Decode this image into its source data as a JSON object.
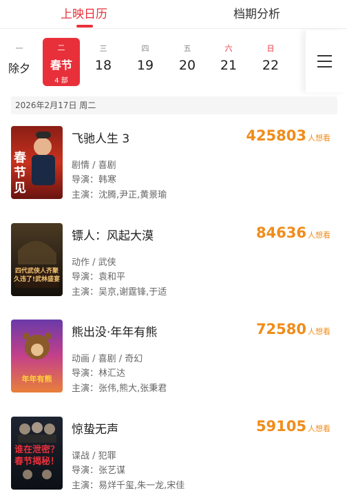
{
  "tabs": {
    "active": "上映日历",
    "inactive": "档期分析"
  },
  "dates": [
    {
      "weekday": "一",
      "day": "除夕",
      "sub": ""
    },
    {
      "weekday": "二",
      "day": "春节",
      "sub": "4 部"
    },
    {
      "weekday": "三",
      "day": "18",
      "sub": ""
    },
    {
      "weekday": "四",
      "day": "19",
      "sub": ""
    },
    {
      "weekday": "五",
      "day": "20",
      "sub": ""
    },
    {
      "weekday": "六",
      "day": "21",
      "sub": ""
    },
    {
      "weekday": "日",
      "day": "22",
      "sub": ""
    }
  ],
  "selected_date_index": 1,
  "menu_icon": "hamburger-menu-icon",
  "date_header": "2026年2月17日  周二",
  "want_unit": "人想看",
  "accent_color": "#e8303a",
  "want_color": "#f08c1a",
  "movies": [
    {
      "title": "飞驰人生 3",
      "want_count": "425803",
      "genre": "剧情 / 喜剧",
      "director": "导演：韩寒",
      "cast": "主演：沈腾,尹正,黄景瑜",
      "poster_text": "春节见"
    },
    {
      "title": "镖人：风起大漠",
      "want_count": "84636",
      "genre": "动作 / 武侠",
      "director": "导演：袁和平",
      "cast": "主演：吴京,谢霆锋,于适",
      "poster_text": "四代武侠人齐聚 久违了!武林盛宴"
    },
    {
      "title": "熊出没·年年有熊",
      "want_count": "72580",
      "genre": "动画 / 喜剧 / 奇幻",
      "director": "导演：林汇达",
      "cast": "主演：张伟,熊大,张秉君",
      "poster_text": "年年有熊"
    },
    {
      "title": "惊蛰无声",
      "want_count": "59105",
      "genre": "谍战 / 犯罪",
      "director": "导演：张艺谋",
      "cast": "主演：易烊千玺,朱一龙,宋佳",
      "poster_text": "谁在泄密？春节揭秘！"
    }
  ]
}
